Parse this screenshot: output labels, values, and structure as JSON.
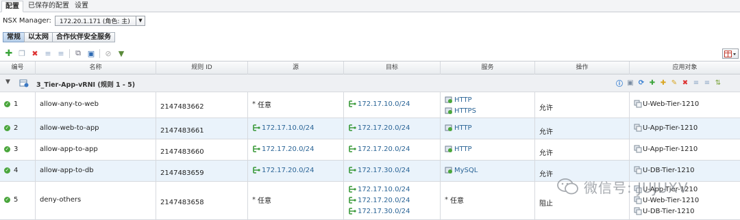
{
  "tabs": [
    "配置",
    "已保存的配置",
    "设置"
  ],
  "manager": {
    "label": "NSX Manager:",
    "value": "172.20.1.171 (角色: 主)"
  },
  "sub_tabs": [
    "常规",
    "以太网",
    "合作伙伴安全服务"
  ],
  "columns": {
    "num": "编号",
    "name": "名称",
    "rule_id": "规则 ID",
    "source": "源",
    "target": "目标",
    "service": "服务",
    "action": "操作",
    "applied_to": "应用对象"
  },
  "section": {
    "title": "3_Tier-App-vRNI (规则 1 - 5)"
  },
  "rules": [
    {
      "num": "1",
      "name": "allow-any-to-web",
      "rule_id": "2147483662",
      "source": [
        "任意"
      ],
      "target": [
        "172.17.10.0/24"
      ],
      "service": [
        "HTTP",
        "HTTPS"
      ],
      "action": "允许",
      "applied_to": [
        "U-Web-Tier-1210"
      ]
    },
    {
      "num": "2",
      "name": "allow-web-to-app",
      "rule_id": "2147483661",
      "source": [
        "172.17.10.0/24"
      ],
      "target": [
        "172.17.20.0/24"
      ],
      "service": [
        "HTTP"
      ],
      "action": "允许",
      "applied_to": [
        "U-App-Tier-1210"
      ]
    },
    {
      "num": "3",
      "name": "allow-app-to-app",
      "rule_id": "2147483660",
      "source": [
        "172.17.20.0/24"
      ],
      "target": [
        "172.17.20.0/24"
      ],
      "service": [
        "HTTP"
      ],
      "action": "允许",
      "applied_to": [
        "U-App-Tier-1210"
      ]
    },
    {
      "num": "4",
      "name": "allow-app-to-db",
      "rule_id": "2147483659",
      "source": [
        "172.17.20.0/24"
      ],
      "target": [
        "172.17.30.0/24"
      ],
      "service": [
        "MySQL"
      ],
      "action": "允许",
      "applied_to": [
        "U-DB-Tier-1210"
      ]
    },
    {
      "num": "5",
      "name": "deny-others",
      "rule_id": "2147483658",
      "source": [
        "任意"
      ],
      "target": [
        "172.17.10.0/24",
        "172.17.20.0/24",
        "172.17.30.0/24"
      ],
      "service": [
        "任意"
      ],
      "action": "阻止",
      "applied_to": [
        "U-App-Tier-1210",
        "U-Web-Tier-1210",
        "U-DB-Tier-1210"
      ]
    }
  ],
  "watermark": "微信号: JUJUXV",
  "colors": {
    "link": "#2a6496",
    "ok": "#4aa63c",
    "alt_row": "#eaf3fb",
    "active_subtab": "#b7cfea"
  }
}
